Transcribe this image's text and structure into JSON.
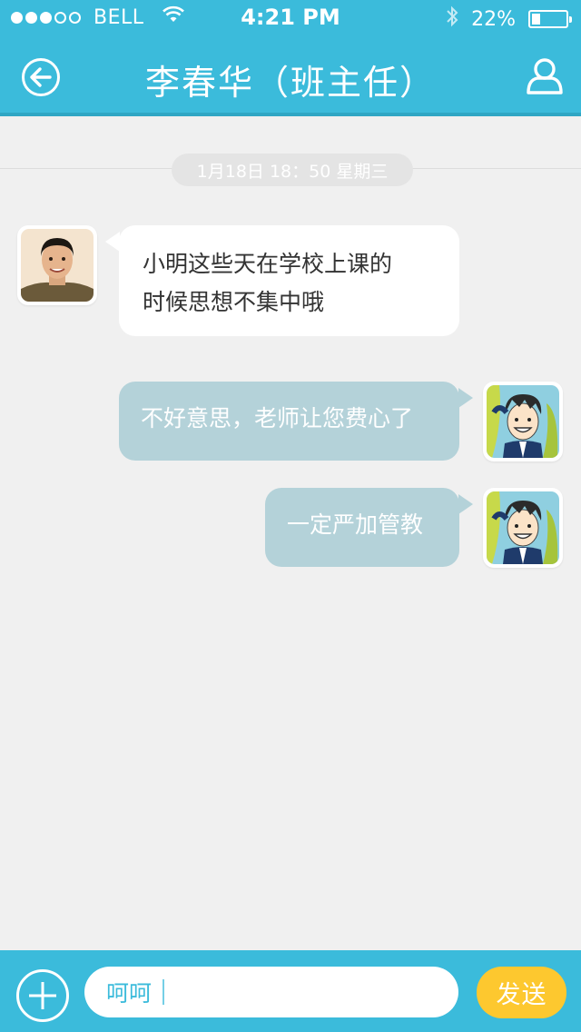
{
  "status_bar": {
    "carrier": "BELL",
    "time": "4:21 PM",
    "battery": "22%",
    "signal_strength": "3 of 5 dots"
  },
  "nav": {
    "title": "李春华（班主任）",
    "back_icon": "circle-arrow-left-icon",
    "profile_icon": "person-outline-icon"
  },
  "chat": {
    "timestamp": "1月18日 18：50 星期三",
    "messages": [
      {
        "direction": "incoming",
        "line1": "小明这些天在学校上课的",
        "line2": "时候思想不集中哦"
      },
      {
        "direction": "outgoing",
        "text": "不好意思，老师让您费心了"
      },
      {
        "direction": "outgoing",
        "text": "一定严加管教"
      }
    ]
  },
  "composer": {
    "input_value": "呵呵",
    "send_label": "发送",
    "add_icon": "circle-plus-icon"
  },
  "colors": {
    "accent": "#3bbbdb",
    "outgoing_bubble": "#b4d2d9",
    "incoming_bubble": "#ffffff",
    "send_button": "#fdc82f",
    "background": "#f0f0f0"
  }
}
